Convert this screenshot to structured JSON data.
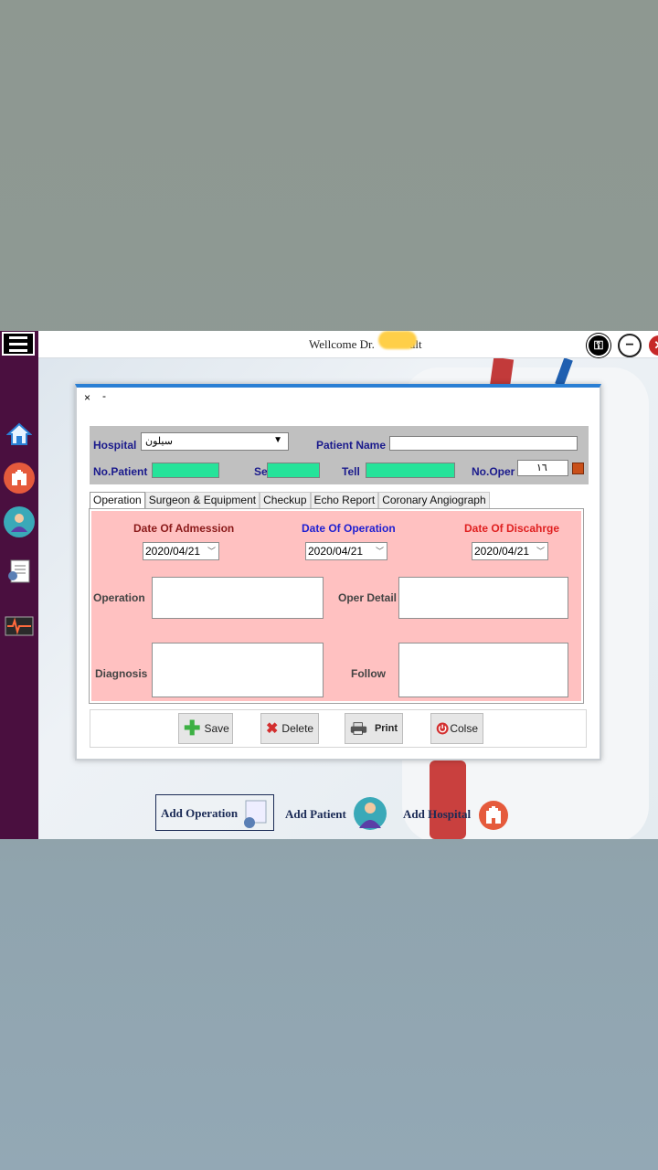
{
  "topbar": {
    "welcome_text": "Wellcome Dr.",
    "name_suffix": "ult"
  },
  "window_controls": {
    "lock": "⚿",
    "minimize": "−",
    "close": "✕"
  },
  "dialog": {
    "close_label": "×",
    "min_label": "-",
    "header": {
      "hospital_label": "Hospital",
      "hospital_value": "سيلون",
      "patient_name_label": "Patient Name",
      "patient_name_value": "",
      "no_patient_label": "No.Patient",
      "sex_label": "Sex",
      "tell_label": "Tell",
      "no_oper_label": "No.Oper",
      "no_oper_value": "١٦"
    },
    "tabs": [
      "Operation",
      "Surgeon & Equipment",
      "Checkup",
      "Echo Report",
      "Coronary Angiograph"
    ],
    "dates": {
      "admission_label": "Date Of Admession",
      "admission_value": "2020/04/21",
      "operation_label": "Date Of Operation",
      "operation_value": "2020/04/21",
      "discharge_label": "Date Of Discahrge",
      "discharge_value": "2020/04/21"
    },
    "fields": {
      "operation_label": "Operation",
      "oper_detail_label": "Oper Detail",
      "diagnosis_label": "Diagnosis",
      "follow_label": "Follow"
    },
    "buttons": {
      "save": "Save",
      "delete": "Delete",
      "print": "Print",
      "close": "Colse"
    }
  },
  "bottom_nav": {
    "add_operation": "Add Operation",
    "add_patient": "Add Patient",
    "add_hospital": "Add Hospital"
  },
  "colors": {
    "sidebar": "#4a0f3f",
    "accent_blue": "#2a7fd4",
    "panel_pink": "#ffc1c1",
    "green_field": "#26e39a",
    "label_navy": "#1a1a8c",
    "label_darkred": "#8b1a1a",
    "label_blue": "#1f1fd1",
    "label_red": "#e02020"
  }
}
